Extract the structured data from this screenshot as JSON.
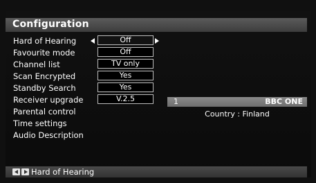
{
  "header": {
    "title": "Configuration"
  },
  "menu": [
    {
      "label": "Hard of Hearing",
      "value": "Off",
      "selected": true
    },
    {
      "label": "Favourite mode",
      "value": "Off"
    },
    {
      "label": "Channel list",
      "value": "TV only"
    },
    {
      "label": "Scan Encrypted",
      "value": "Yes"
    },
    {
      "label": "Standby Search",
      "value": "Yes"
    },
    {
      "label": "Receiver upgrade",
      "value": "V.2.5"
    },
    {
      "label": "Parental control"
    },
    {
      "label": "Time settings"
    },
    {
      "label": "Audio Description"
    }
  ],
  "channel_info": {
    "number": "1",
    "name": "BBC ONE",
    "country": "Country : Finland"
  },
  "footer": {
    "hint": "Hard of Hearing",
    "left_key_icon": "arrow-left-key-icon",
    "right_key_icon": "arrow-right-key-icon"
  },
  "colors": {
    "title_bar": "#4d4d4d",
    "channel_bar": "#7c7c7c",
    "panel_bg": "#0e0e0e"
  }
}
